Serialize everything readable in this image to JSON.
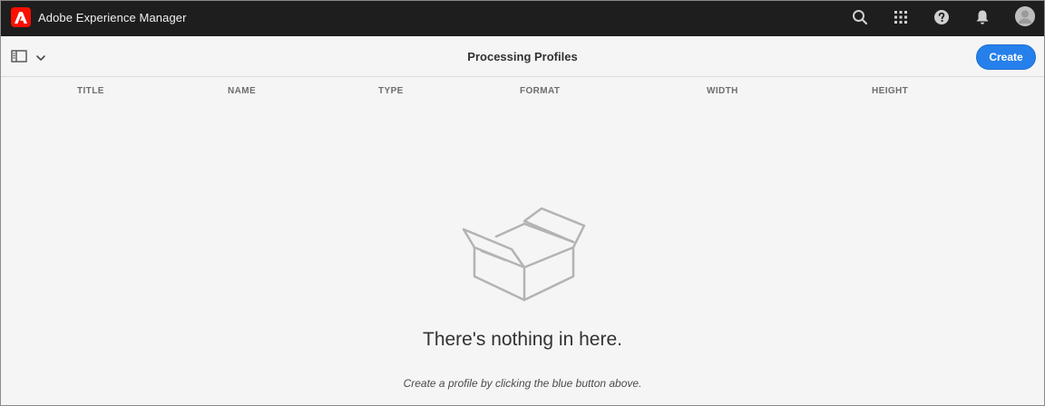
{
  "shell": {
    "app_title": "Adobe Experience Manager",
    "icons": [
      "search-icon",
      "apps-grid-icon",
      "help-icon",
      "bell-icon",
      "avatar"
    ]
  },
  "actionbar": {
    "page_title": "Processing Profiles",
    "create_label": "Create"
  },
  "table": {
    "columns": [
      "TITLE",
      "NAME",
      "TYPE",
      "FORMAT",
      "WIDTH",
      "HEIGHT"
    ]
  },
  "empty_state": {
    "title": "There's nothing in here.",
    "subtitle": "Create a profile by clicking the blue button above."
  },
  "colors": {
    "shell_bg": "#1e1e1e",
    "accent": "#2680eb",
    "logo_red": "#fa0f00",
    "page_bg": "#f5f5f5"
  }
}
